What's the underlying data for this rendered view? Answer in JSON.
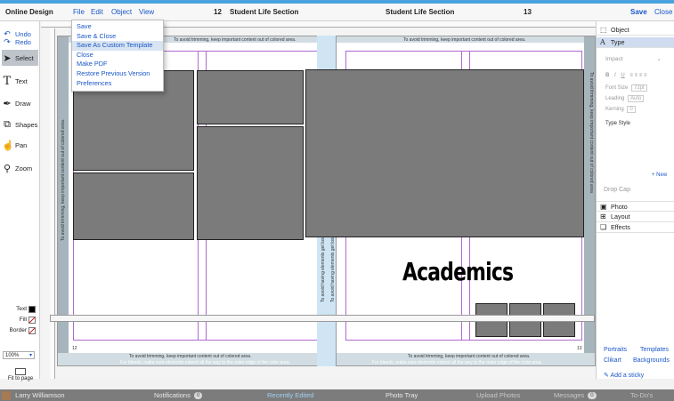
{
  "header": {
    "app_title": "Online Design",
    "menu": [
      "File",
      "Edit",
      "Object",
      "View"
    ],
    "left_page_number": "12",
    "left_page_section": "Student Life Section",
    "right_page_section": "Student Life Section",
    "right_page_number": "13",
    "save_label": "Save",
    "close_label": "Close"
  },
  "file_menu": {
    "items": [
      "Save",
      "Save & Close",
      "Save As Custom Template",
      "Close",
      "Make PDF",
      "Restore Previous Version",
      "Preferences"
    ],
    "highlighted_index": 2
  },
  "left_toolbar": {
    "undo": "Undo",
    "redo": "Redo",
    "tools": [
      "Select",
      "Text",
      "Draw",
      "Shapes",
      "Pan",
      "Zoom"
    ],
    "active_tool": "Select",
    "swatches": {
      "text": "Text",
      "fill": "Fill",
      "border": "Border"
    },
    "zoom_value": "100%",
    "fit_to_page": "Fit to page"
  },
  "canvas": {
    "trim_notice": "To avoid trimming, keep important content out of colored area.",
    "bleed_notice": "For bleeds, make sure elements extend all the way to the outer edge of the color area.",
    "gutter_notice": "To avoid having elements get lost",
    "left_page_num": "12",
    "right_page_num": "13",
    "headline": "Academics"
  },
  "right_panel": {
    "object": "Object",
    "type": "Type",
    "font": "Impact",
    "style_buttons": [
      "B",
      "I",
      "U"
    ],
    "font_size_label": "Font Size",
    "font_size_value": "72pt",
    "leading_label": "Leading",
    "leading_value": "Auto",
    "kerning_label": "Kerning",
    "kerning_value": "0",
    "type_style": "Type Style",
    "new_label": "+ New",
    "drop_cap": "Drop Cap",
    "sections": [
      "Photo",
      "Layout",
      "Effects"
    ],
    "library_links": [
      "Portraits",
      "Templates",
      "Clikart",
      "Backgrounds"
    ],
    "add_sticky": "Add a sticky"
  },
  "bottom_bar": {
    "user": "Larry Williamson",
    "notifications": "Notifications",
    "notifications_count": "0",
    "recently_edited": "Recently Edited",
    "photo_tray": "Photo Tray",
    "upload_photos": "Upload Photos",
    "messages": "Messages",
    "messages_count": "0",
    "todos": "To-Do's"
  },
  "colors": {
    "accent": "#4aa3df",
    "link": "#1a57c8",
    "margin_band": "#a6b4bc",
    "photo_placeholder": "#7b7b7b",
    "guide": "#b06ad0"
  }
}
